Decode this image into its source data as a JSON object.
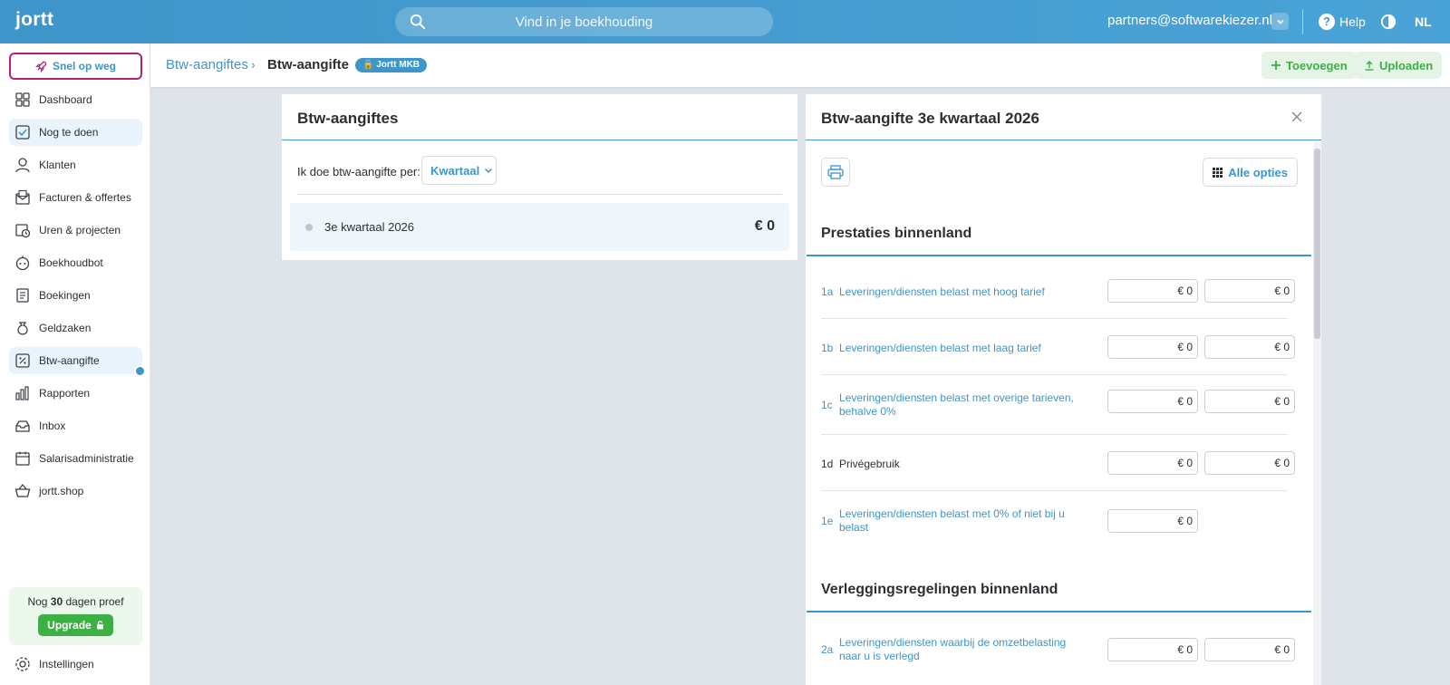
{
  "topbar": {
    "logo": "jortt",
    "search_placeholder": "Vind in je boekhouding",
    "account": "partners@softwarekiezer.nl",
    "help": "Help",
    "language": "NL"
  },
  "sidebar": {
    "quickstart": "Snel op weg",
    "items": [
      {
        "label": "Dashboard"
      },
      {
        "label": "Nog te doen"
      },
      {
        "label": "Klanten"
      },
      {
        "label": "Facturen & offertes"
      },
      {
        "label": "Uren & projecten"
      },
      {
        "label": "Boekhoudbot"
      },
      {
        "label": "Boekingen"
      },
      {
        "label": "Geldzaken"
      },
      {
        "label": "Btw-aangifte"
      },
      {
        "label": "Rapporten"
      },
      {
        "label": "Inbox"
      },
      {
        "label": "Salarisadministratie"
      },
      {
        "label": "jortt.shop"
      }
    ],
    "trial": {
      "prefix": "Nog",
      "days": "30",
      "suffix": "dagen proef",
      "upgrade": "Upgrade"
    },
    "settings": "Instellingen"
  },
  "header": {
    "breadcrumb_parent": "Btw-aangiftes",
    "breadcrumb_current": "Btw-aangifte",
    "plan_badge": "Jortt MKB",
    "add": "Toevoegen",
    "upload": "Uploaden"
  },
  "left_panel": {
    "title": "Btw-aangiftes",
    "period_label": "Ik doe btw-aangifte per:",
    "period_value": "Kwartaal",
    "periods": [
      {
        "name": "3e kwartaal 2026",
        "amount": "€ 0"
      }
    ]
  },
  "right_panel": {
    "title": "Btw-aangifte 3e kwartaal 2026",
    "all_options": "Alle opties",
    "sections": [
      {
        "title": "Prestaties binnenland",
        "rows": [
          {
            "code": "1a",
            "label": "Leveringen/diensten belast met hoog tarief",
            "v1": "€ 0",
            "v2": "€ 0"
          },
          {
            "code": "1b",
            "label": "Leveringen/diensten belast met laag tarief",
            "v1": "€ 0",
            "v2": "€ 0"
          },
          {
            "code": "1c",
            "label": "Leveringen/diensten belast met overige tarieven, behalve 0%",
            "v1": "€ 0",
            "v2": "€ 0"
          },
          {
            "code": "1d",
            "label": "Privégebruik",
            "v1": "€ 0",
            "v2": "€ 0"
          },
          {
            "code": "1e",
            "label": "Leveringen/diensten belast met 0% of niet bij u belast",
            "v1": "€ 0"
          }
        ]
      },
      {
        "title": "Verleggingsregelingen binnenland",
        "rows": [
          {
            "code": "2a",
            "label": "Leveringen/diensten waarbij de omzetbelasting naar u is verlegd",
            "v1": "€ 0",
            "v2": "€ 0"
          }
        ]
      }
    ]
  },
  "colors": {
    "brand": "#3e95c9",
    "green": "#3cb043",
    "quickstart_border": "#b0237a",
    "canvas": "#dfe3ea"
  }
}
